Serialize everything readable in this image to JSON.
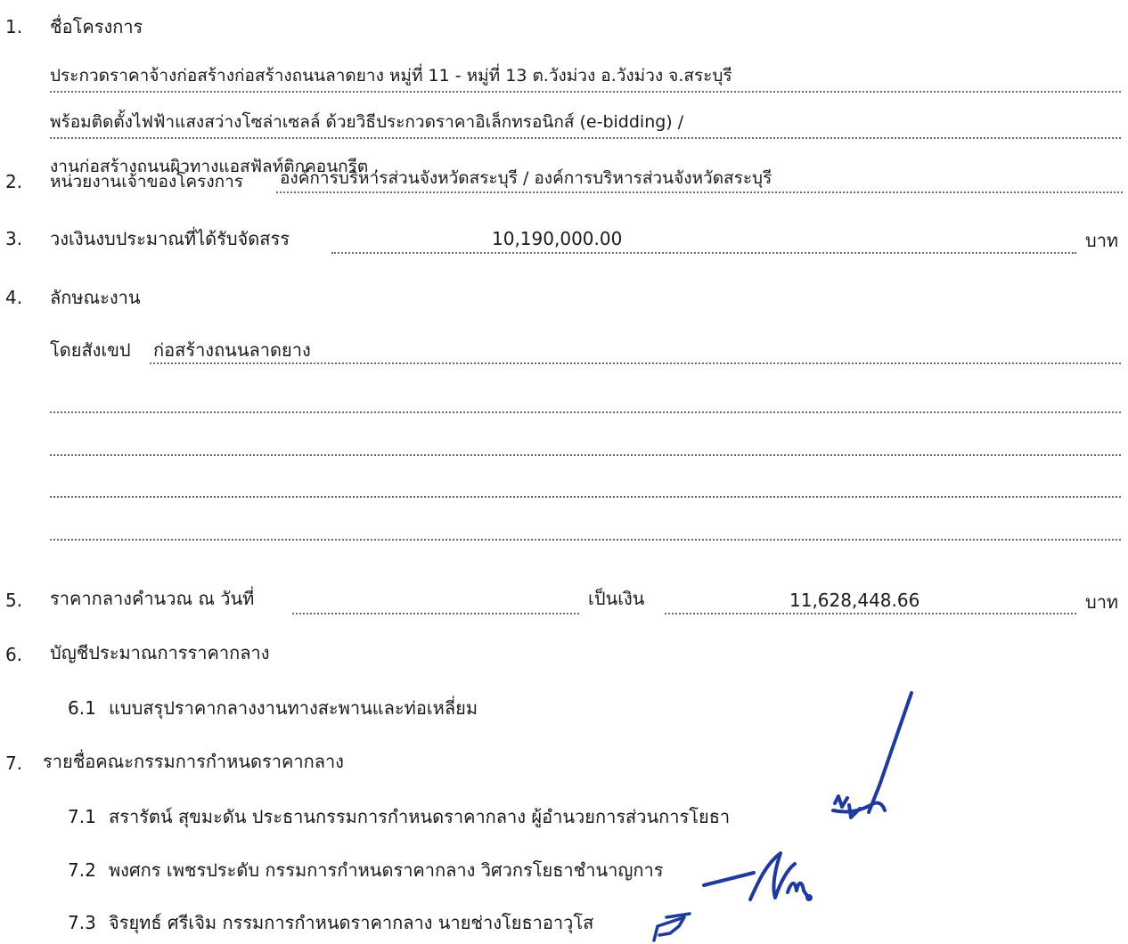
{
  "doc": {
    "s1": {
      "num": "1.",
      "label": "ชื่อโครงการ",
      "line1": "ประกวดราคาจ้างก่อสร้างก่อสร้างถนนลาดยาง หมู่ที่ 11 - หมู่ที่ 13 ต.วังม่วง อ.วังม่วง จ.สระบุรี",
      "line2": "พร้อมติดตั้งไฟฟ้าแสงสว่างโซล่าเซลล์ ด้วยวิธีประกวดราคาอิเล็กทรอนิกส์ (e-bidding) /",
      "line3": "งานก่อสร้างถนนผิวทางแอสฟัลท์ติกคอนกรีต ,"
    },
    "s2": {
      "num": "2.",
      "label": "หน่วยงานเจ้าของโครงการ",
      "value": "องค์การบริหารส่วนจังหวัดสระบุรี / องค์การบริหารส่วนจังหวัดสระบุรี"
    },
    "s3": {
      "num": "3.",
      "label": "วงเงินงบประมาณที่ได้รับจัดสรร",
      "value": "10,190,000.00",
      "unit": "บาท"
    },
    "s4": {
      "num": "4.",
      "label": "ลักษณะงาน",
      "summary_label": "โดยสังเขป",
      "summary_value": "ก่อสร้างถนนลาดยาง"
    },
    "s5": {
      "num": "5.",
      "label": "ราคากลางคำนวณ ณ วันที่",
      "date_value": "",
      "amount_label": "เป็นเงิน",
      "amount_value": "11,628,448.66",
      "unit": "บาท"
    },
    "s6": {
      "num": "6.",
      "label": "บัญชีประมาณการราคากลาง",
      "item_num": "6.1",
      "item_text": "แบบสรุปราคากลางงานทางสะพานและท่อเหลี่ยม"
    },
    "s7": {
      "num": "7.",
      "label": "รายชื่อคณะกรรมการกำหนดราคากลาง",
      "members": [
        {
          "num": "7.1",
          "text": "สรารัตน์ สุขมะดัน ประธานกรรมการกำหนดราคากลาง ผู้อำนวยการส่วนการโยธา"
        },
        {
          "num": "7.2",
          "text": "พงศกร เพชรประดับ กรรมการกำหนดราคากลาง วิศวกรโยธาชำนาญการ"
        },
        {
          "num": "7.3",
          "text": "จิรยุทธ์ ศรีเจิม กรรมการกำหนดราคากลาง นายช่างโยธาอาวุโส"
        }
      ]
    },
    "colors": {
      "ink": "#1a1a1a",
      "dots": "#6a6a6a",
      "signature": "#1f3a9e"
    }
  }
}
